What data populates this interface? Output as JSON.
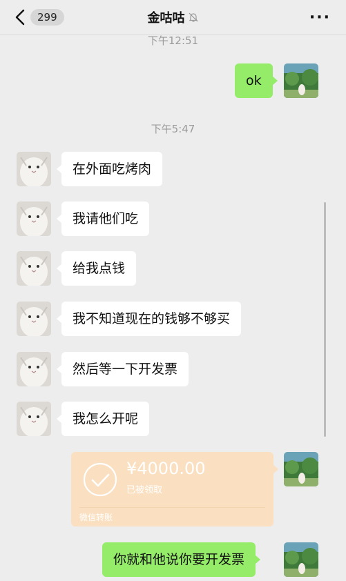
{
  "header": {
    "back_count": "299",
    "title": "金咕咕",
    "more": "···"
  },
  "timestamps": [
    "下午12:51",
    "下午5:47"
  ],
  "messages": [
    {
      "side": "right",
      "text": "ok"
    },
    {
      "side": "left",
      "text": "在外面吃烤肉"
    },
    {
      "side": "left",
      "text": "我请他们吃"
    },
    {
      "side": "left",
      "text": "给我点钱"
    },
    {
      "side": "left",
      "text": "我不知道现在的钱够不够买"
    },
    {
      "side": "left",
      "text": "然后等一下开发票"
    },
    {
      "side": "left",
      "text": "我怎么开呢"
    },
    {
      "side": "right",
      "text": "你就和他说你要开发票"
    }
  ],
  "transfer": {
    "amount": "¥4000.00",
    "status": "已被领取",
    "label": "微信转账",
    "color": "#fae0c1"
  },
  "colors": {
    "background": "#ededed",
    "self_bubble": "#95ec69",
    "other_bubble": "#ffffff"
  }
}
